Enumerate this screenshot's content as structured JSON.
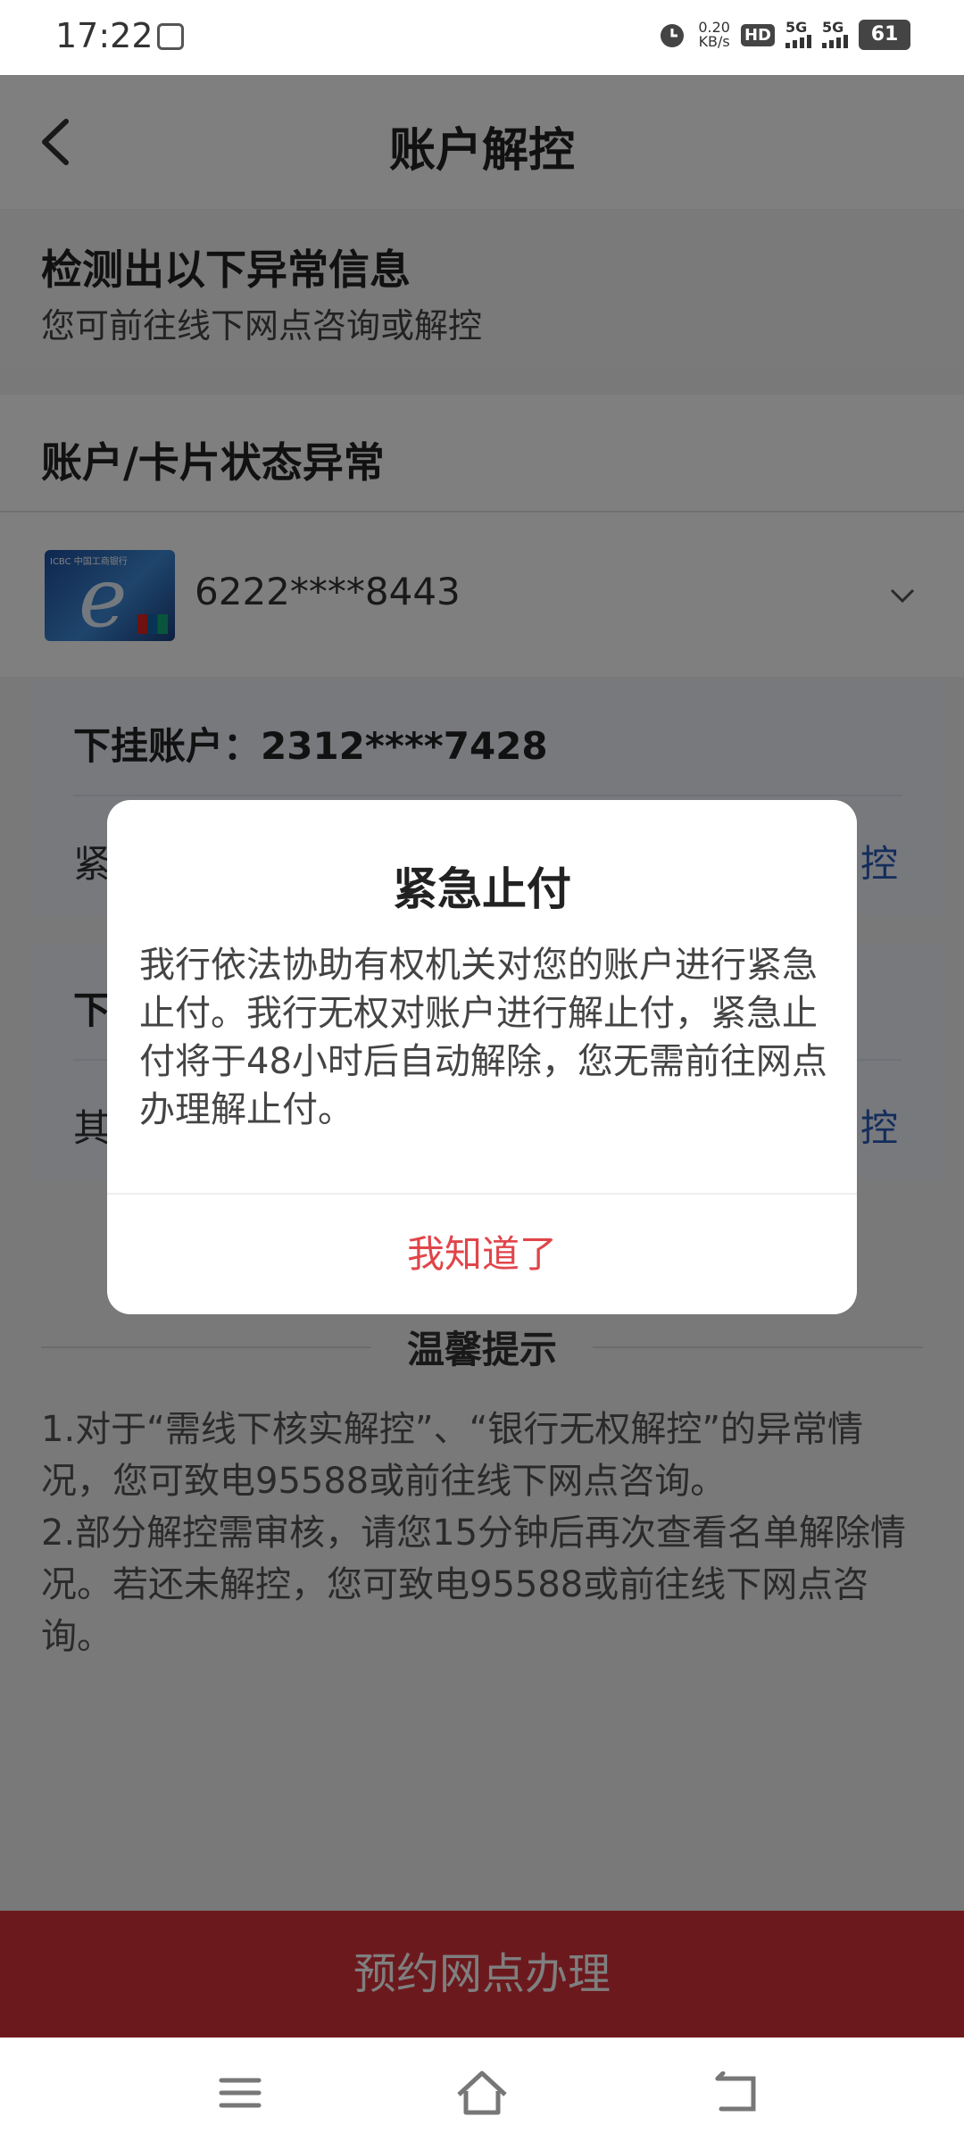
{
  "status_bar": {
    "time": "17:22",
    "speed": "0.20",
    "speed_unit": "KB/s",
    "hd": "HD",
    "net1": "5G",
    "net2": "5G",
    "battery": "61"
  },
  "header": {
    "title": "账户解控"
  },
  "notice": {
    "title": "检测出以下异常信息",
    "subtitle": "您可前往线下网点咨询或解控"
  },
  "section": {
    "title": "账户/卡片状态异常"
  },
  "card": {
    "number": "6222****8443",
    "brand": "ICBC 中国工商银行"
  },
  "panels": [
    {
      "line1": "下挂账户：2312****7428",
      "left": "紧",
      "right": "控"
    },
    {
      "line1": "下",
      "left": "其",
      "right": "控"
    }
  ],
  "tips": {
    "title": "温馨提示",
    "line1": "1.对于“需线下核实解控”、“银行无权解控”的异常情况，您可致电95588或前往线下网点咨询。",
    "line2": "2.部分解控需审核，请您15分钟后再次查看名单解除情况。若还未解控，您可致电95588或前往线下网点咨询。"
  },
  "bottom_button": "预约网点办理",
  "dialog": {
    "title": "紧急止付",
    "body": "我行依法协助有权机关对您的账户进行紧急止付。我行无权对账户进行解止付，紧急止付将于48小时后自动解除，您无需前往网点办理解止付。",
    "button": "我知道了"
  },
  "colors": {
    "primary_red": "#d8333a",
    "link_blue": "#2a5ab8",
    "dialog_button": "#e0454a"
  }
}
